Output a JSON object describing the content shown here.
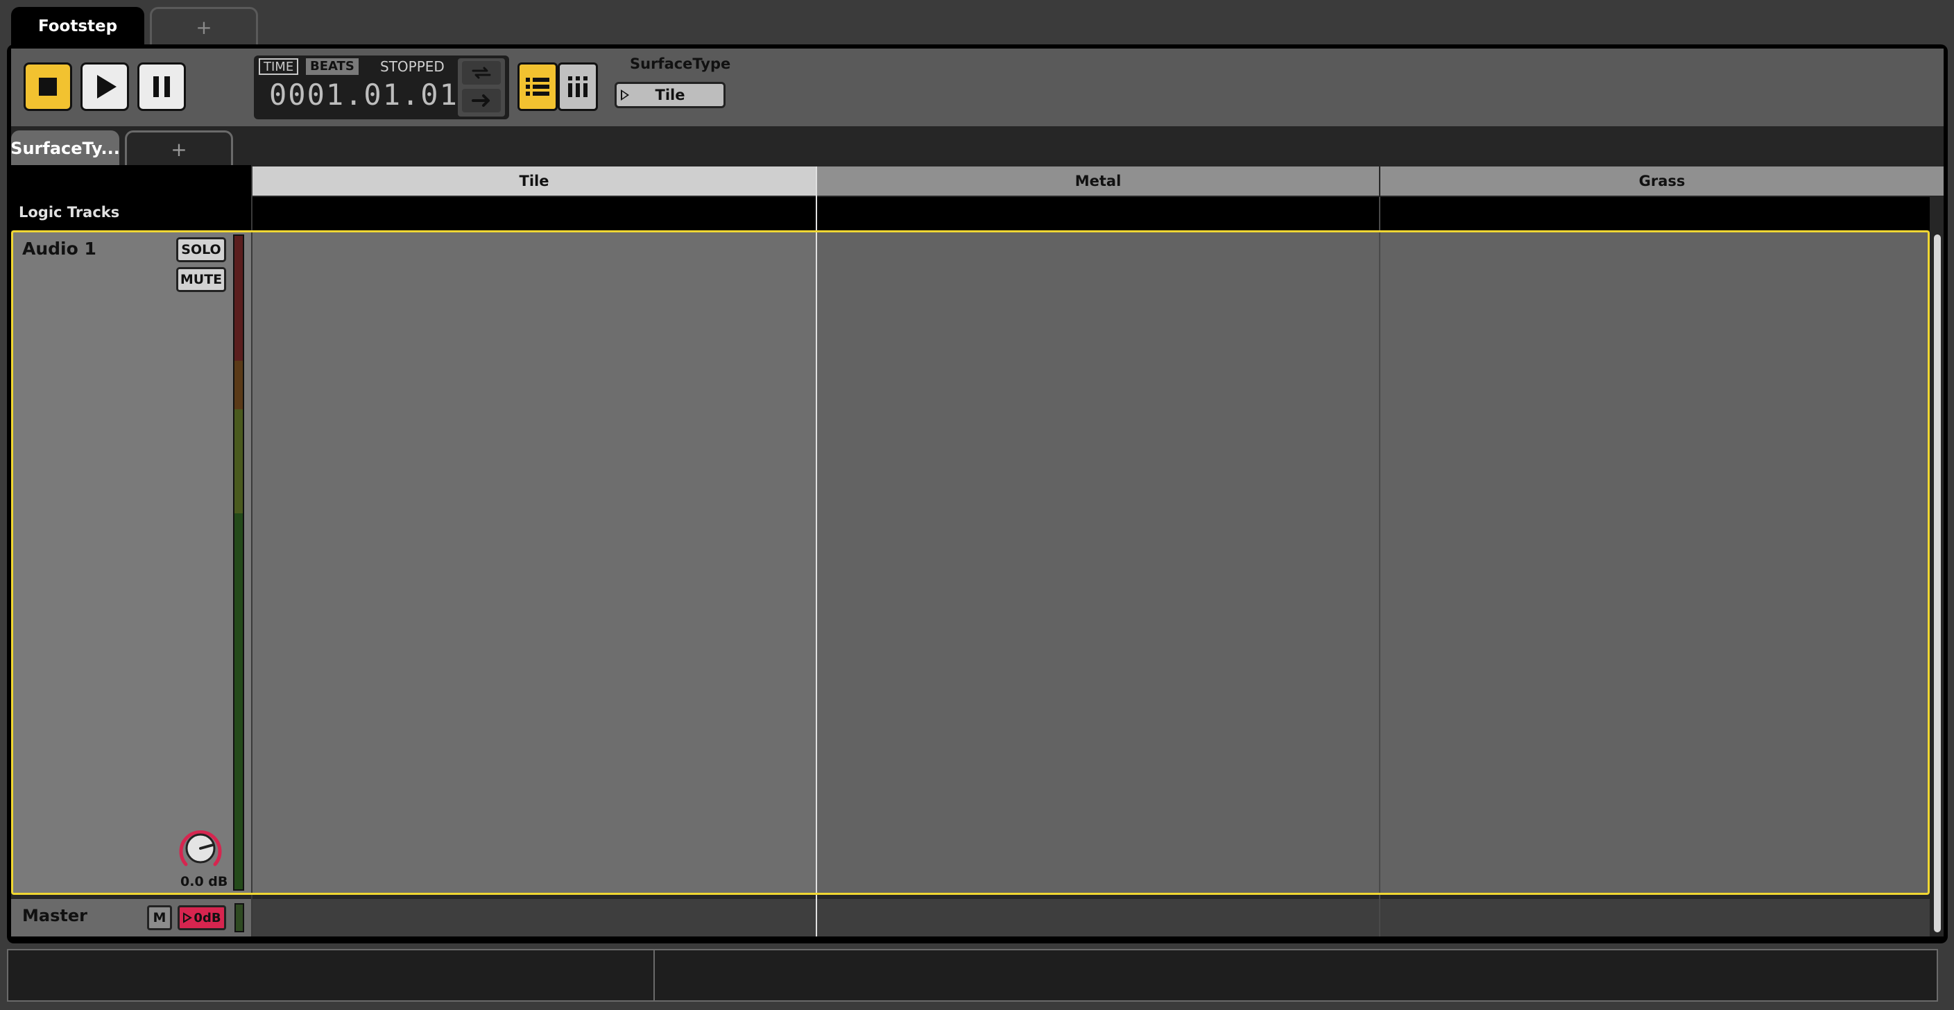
{
  "document_tabs": [
    {
      "label": "Footstep",
      "active": true
    },
    {
      "label": "+"
    }
  ],
  "transport": {
    "time_label": "TIME",
    "beats_label": "BEATS",
    "status": "STOPPED",
    "position": "0001.01.01",
    "stop_icon": "stop-icon",
    "play_icon": "play-icon",
    "pause_icon": "pause-icon",
    "loop_icon": "loop-icon",
    "oneshot_icon": "arrow-right-icon"
  },
  "view_buttons": {
    "list_icon": "list-view-icon",
    "grid_icon": "grid-view-icon"
  },
  "parameter": {
    "label": "SurfaceType",
    "value": "Tile"
  },
  "parameter_tabs": [
    {
      "label": "SurfaceTy...",
      "active": true
    },
    {
      "label": "+"
    }
  ],
  "columns": [
    {
      "label": "Tile",
      "selected": true
    },
    {
      "label": "Metal"
    },
    {
      "label": "Grass"
    }
  ],
  "logic_tracks_label": "Logic Tracks",
  "track": {
    "name": "Audio 1",
    "solo_label": "SOLO",
    "mute_label": "MUTE",
    "volume": "0.0 dB"
  },
  "master": {
    "name": "Master",
    "mute_label": "M",
    "volume_label": "0dB"
  },
  "colors": {
    "accent_yellow": "#f2c230",
    "selection_outline": "#f0d733",
    "volume_red": "#d6254f"
  }
}
